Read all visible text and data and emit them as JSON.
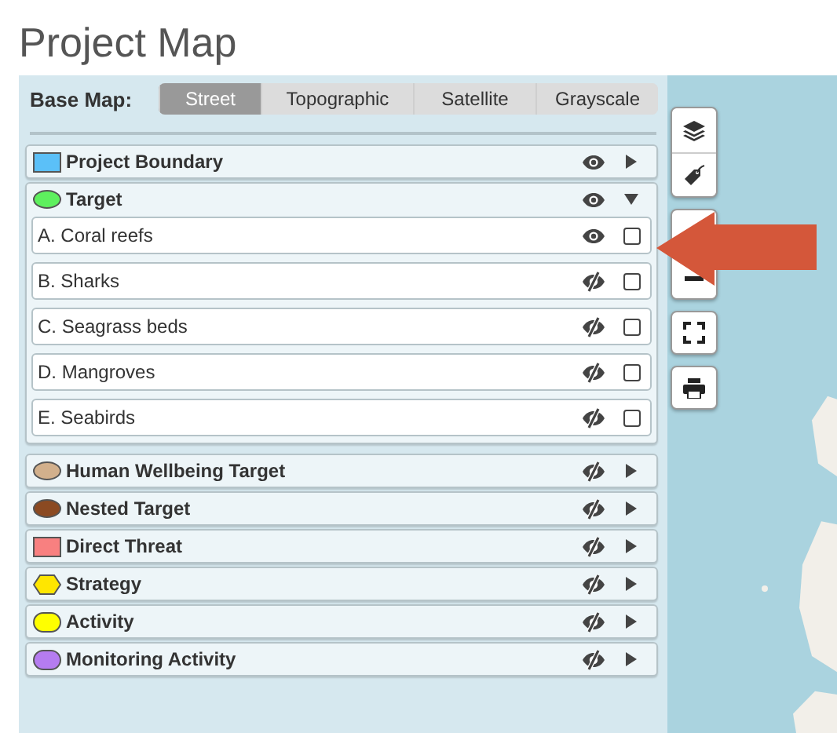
{
  "title": "Project Map",
  "base_map": {
    "label": "Base Map:",
    "options": [
      {
        "label": "Street",
        "selected": true
      },
      {
        "label": "Topographic",
        "selected": false
      },
      {
        "label": "Satellite",
        "selected": false
      },
      {
        "label": "Grayscale",
        "selected": false
      }
    ]
  },
  "layers": [
    {
      "name": "Project Boundary",
      "kind": "rect",
      "color": "#5bc0f8",
      "visible": true,
      "expanded": false
    },
    {
      "name": "Target",
      "kind": "ellipse",
      "color": "#5ef05e",
      "visible": true,
      "expanded": true,
      "children": [
        {
          "name": "A. Coral reefs",
          "visible": true,
          "checked": false
        },
        {
          "name": "B. Sharks",
          "visible": false,
          "checked": false
        },
        {
          "name": "C. Seagrass beds",
          "visible": false,
          "checked": false
        },
        {
          "name": "D. Mangroves",
          "visible": false,
          "checked": false
        },
        {
          "name": "E. Seabirds",
          "visible": false,
          "checked": false
        }
      ]
    },
    {
      "name": "Human Wellbeing Target",
      "kind": "ellipse",
      "color": "#d2b08c",
      "visible": false,
      "expanded": false
    },
    {
      "name": "Nested Target",
      "kind": "ellipse",
      "color": "#8b4a22",
      "visible": false,
      "expanded": false
    },
    {
      "name": "Direct Threat",
      "kind": "rect",
      "color": "#f88080",
      "visible": false,
      "expanded": false
    },
    {
      "name": "Strategy",
      "kind": "hexagon",
      "color": "#ffe600",
      "visible": false,
      "expanded": false
    },
    {
      "name": "Activity",
      "kind": "rounded",
      "color": "#ffff00",
      "visible": false,
      "expanded": false
    },
    {
      "name": "Monitoring Activity",
      "kind": "rounded",
      "color": "#b57cf0",
      "visible": false,
      "expanded": false
    }
  ]
}
